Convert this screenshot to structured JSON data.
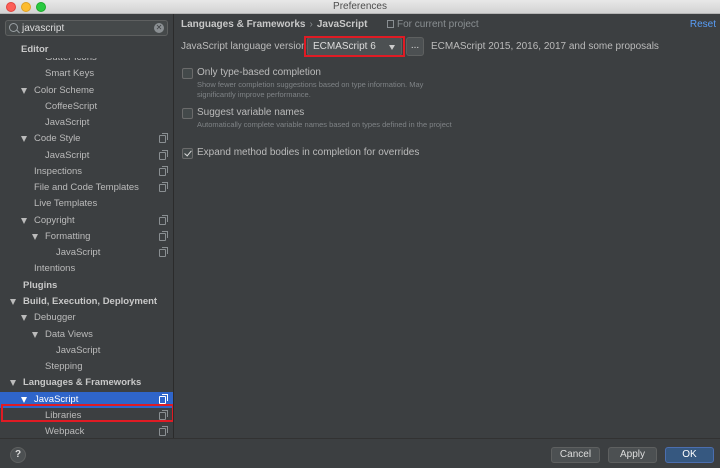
{
  "window": {
    "title": "Preferences"
  },
  "search": {
    "value": "javascript"
  },
  "tree": [
    {
      "label": "Editor",
      "bold": true
    },
    {
      "label": "Gutter Icons"
    },
    {
      "label": "Smart Keys"
    },
    {
      "label": "Color Scheme"
    },
    {
      "label": "CoffeeScript"
    },
    {
      "label": "JavaScript"
    },
    {
      "label": "Code Style"
    },
    {
      "label": "JavaScript"
    },
    {
      "label": "Inspections"
    },
    {
      "label": "File and Code Templates"
    },
    {
      "label": "Live Templates"
    },
    {
      "label": "Copyright"
    },
    {
      "label": "Formatting"
    },
    {
      "label": "JavaScript"
    },
    {
      "label": "Intentions"
    },
    {
      "label": "Plugins",
      "bold": true
    },
    {
      "label": "Build, Execution, Deployment",
      "bold": true
    },
    {
      "label": "Debugger"
    },
    {
      "label": "Data Views"
    },
    {
      "label": "JavaScript"
    },
    {
      "label": "Stepping"
    },
    {
      "label": "Languages & Frameworks",
      "bold": true
    },
    {
      "label": "JavaScript",
      "selected": true
    },
    {
      "label": "Libraries"
    },
    {
      "label": "Webpack"
    }
  ],
  "header": {
    "crumb_parent": "Languages & Frameworks",
    "crumb_separator": "›",
    "crumb_current": "JavaScript",
    "scope": "For current project",
    "reset": "Reset"
  },
  "lang": {
    "label": "JavaScript language version",
    "value": "ECMAScript 6",
    "more": "...",
    "description": "ECMAScript 2015, 2016, 2017 and some proposals"
  },
  "options": [
    {
      "label": "Only type-based completion",
      "hint": "Show fewer completion suggestions based on type information. May significantly improve performance.",
      "checked": false
    },
    {
      "label": "Suggest variable names",
      "hint": "Automatically complete variable names based on types defined in the project",
      "checked": false
    },
    {
      "label": "Expand method bodies in completion for overrides",
      "hint": "",
      "checked": true
    }
  ],
  "footer": {
    "help": "?",
    "cancel": "Cancel",
    "apply": "Apply",
    "ok": "OK"
  }
}
